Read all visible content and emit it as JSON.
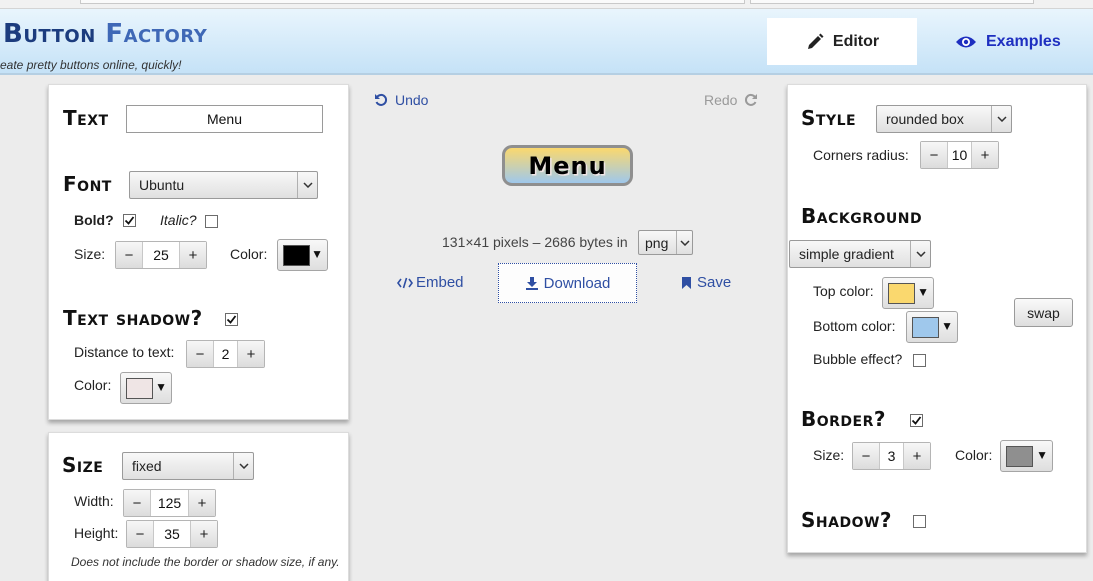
{
  "header": {
    "logo_part1": "Button",
    "logo_part2": "Factory",
    "tagline": "eate pretty buttons online, quickly!",
    "tab_editor": "Editor",
    "tab_examples": "Examples"
  },
  "text_panel": {
    "title": "Text",
    "text_value": "Menu",
    "font_title": "Font",
    "font_value": "Ubuntu",
    "bold_label": "Bold?",
    "bold_checked": true,
    "italic_label": "Italic?",
    "italic_checked": false,
    "size_label": "Size:",
    "size_value": "25",
    "color_label": "Color:",
    "color": "#000000",
    "shadow_title": "Text shadow?",
    "shadow_checked": true,
    "distance_label": "Distance to text:",
    "distance_value": "2",
    "shadow_color_label": "Color:",
    "shadow_color": "#efe5e5"
  },
  "size_panel": {
    "title": "Size",
    "mode_value": "fixed",
    "width_label": "Width:",
    "width_value": "125",
    "height_label": "Height:",
    "height_value": "35",
    "note": "Does not include the border or shadow size, if any."
  },
  "preview": {
    "undo_label": "Undo",
    "redo_label": "Redo",
    "button_text": "Menu",
    "info_text": "131×41 pixels – 2686 bytes in",
    "format_value": "png",
    "embed_label": "Embed",
    "download_label": "Download",
    "save_label": "Save"
  },
  "style_panel": {
    "title": "Style",
    "style_value": "rounded box",
    "corners_label": "Corners radius:",
    "corners_value": "10",
    "background_title": "Background",
    "background_value": "simple gradient",
    "top_color_label": "Top color:",
    "top_color": "#fad86e",
    "bottom_color_label": "Bottom color:",
    "bottom_color": "#9fc8ec",
    "swap_label": "swap",
    "bubble_label": "Bubble effect?",
    "bubble_checked": false,
    "border_title": "Border?",
    "border_checked": true,
    "border_size_label": "Size:",
    "border_size_value": "3",
    "border_color_label": "Color:",
    "border_color": "#8f8f8f",
    "shadow_title": "Shadow?",
    "shadow_checked": false
  }
}
